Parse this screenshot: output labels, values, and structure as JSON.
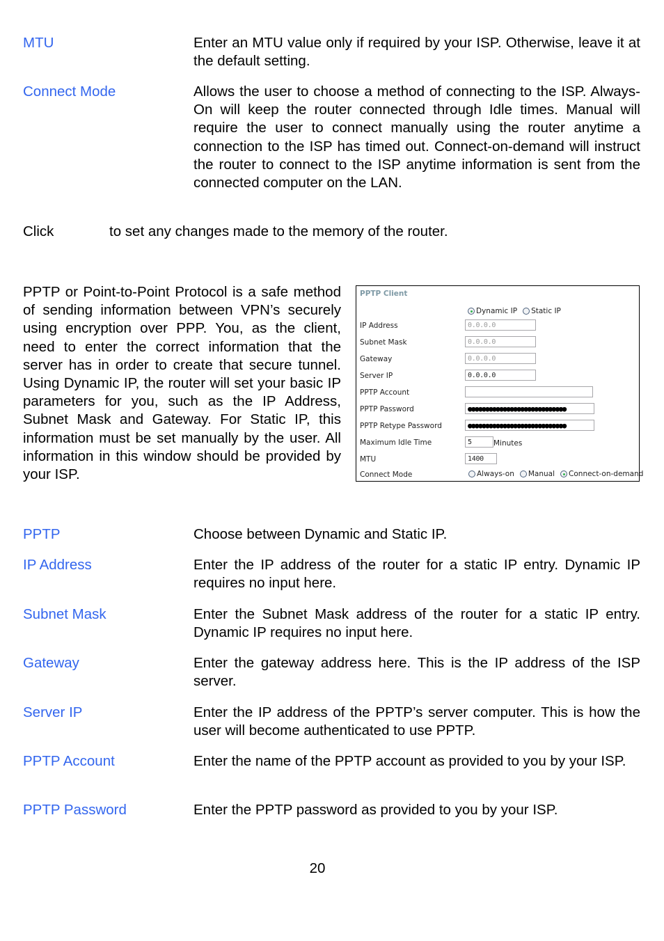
{
  "top_definitions": [
    {
      "term": "MTU",
      "description": "Enter an MTU value only if required by your ISP. Otherwise, leave it at the default setting."
    },
    {
      "term": "Connect Mode",
      "description": "Allows the user to choose a method of connecting to the ISP. Always-On will keep the router connected through Idle times. Manual will require the user to connect manually using the router anytime a connection to the ISP has timed out. Connect-on-demand will instruct the router to connect to the ISP anytime information is sent from the connected computer on the LAN."
    }
  ],
  "click_line": {
    "prefix": "Click",
    "suffix": "to set any changes made to the memory of the router."
  },
  "intro_paragraph": "PPTP or Point-to-Point Protocol is a safe method of sending information between VPN’s securely using encryption over PPP. You, as the client, need to enter the correct information that the server has in order to create that secure tunnel. Using Dynamic IP, the router will set your basic IP parameters for you, such as the IP Address, Subnet Mask and Gateway. For Static IP, this information must be set manually by the user. All information in this window should be provided by your ISP.",
  "panel": {
    "title": "PPTP Client",
    "ip_mode": {
      "options": [
        "Dynamic IP",
        "Static IP"
      ],
      "selected": "Dynamic IP"
    },
    "fields": {
      "ip_address": {
        "label": "IP Address",
        "value": "0.0.0.0"
      },
      "subnet_mask": {
        "label": "Subnet Mask",
        "value": "0.0.0.0"
      },
      "gateway": {
        "label": "Gateway",
        "value": "0.0.0.0"
      },
      "server_ip": {
        "label": "Server IP",
        "value": "0.0.0.0"
      },
      "pptp_account": {
        "label": "PPTP Account",
        "value": ""
      },
      "pptp_password": {
        "label": "PPTP Password",
        "value": "●●●●●●●●●●●●●●●●●●●●●●●●●●●●"
      },
      "pptp_retype_password": {
        "label": "PPTP Retype Password",
        "value": "●●●●●●●●●●●●●●●●●●●●●●●●●●●●"
      },
      "max_idle_time": {
        "label": "Maximum Idle Time",
        "value": "5",
        "unit": "Minutes"
      },
      "mtu": {
        "label": "MTU",
        "value": "1400"
      }
    },
    "connect_mode": {
      "label": "Connect Mode",
      "options": [
        "Always-on",
        "Manual",
        "Connect-on-demand"
      ],
      "selected": "Connect-on-demand"
    }
  },
  "definitions": [
    {
      "term": "PPTP",
      "description": "Choose between Dynamic and Static IP."
    },
    {
      "term": "IP Address",
      "description": "Enter the IP address of the router for a static IP entry. Dynamic IP requires no input here."
    },
    {
      "term": "Subnet Mask",
      "description": "Enter the Subnet Mask address of the router for a static IP entry. Dynamic IP requires no input here."
    },
    {
      "term": "Gateway",
      "description": "Enter the gateway address here. This is the IP address of the ISP server."
    },
    {
      "term": "Server IP",
      "description": "Enter the IP address of the PPTP’s server computer. This is how the user will become authenticated to use PPTP."
    },
    {
      "term": "PPTP Account",
      "description": "Enter the name of the PPTP account as provided to you by your ISP."
    },
    {
      "term": "PPTP Password",
      "description": "Enter the PPTP password as provided to you by your ISP."
    }
  ],
  "page_number": "20",
  "colors": {
    "term": "#3366ee",
    "panel_title": "#7f9aa6",
    "radio_dot": "#2fb24a"
  }
}
